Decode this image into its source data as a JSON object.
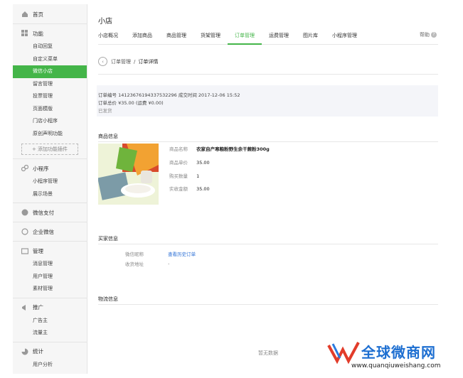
{
  "sidebar": {
    "home": "首页",
    "func_group": "功能",
    "func_items": [
      "自动回复",
      "自定义菜单",
      "微信小店",
      "留言管理",
      "投票管理",
      "页面模版",
      "门店小程序",
      "原创声明功能"
    ],
    "add_plugin": "+ 添加功能插件",
    "mini_group": "小程序",
    "mini_items": [
      "小程序管理",
      "展示场景"
    ],
    "pay": "微信支付",
    "work": "企业微信",
    "manage_group": "管理",
    "manage_items": [
      "消息管理",
      "用户管理",
      "素材管理"
    ],
    "promo_group": "推广",
    "promo_items": [
      "广告主",
      "流量主"
    ],
    "stats_group": "统计",
    "stats_items": [
      "用户分析"
    ]
  },
  "header": {
    "title": "小店",
    "tabs": [
      "小店概况",
      "添加商品",
      "商品管理",
      "货架管理",
      "订单管理",
      "运费管理",
      "图片库",
      "小程序管理"
    ],
    "active_tab": "订单管理",
    "help": "帮助"
  },
  "breadcrumb": {
    "parent": "订单管理",
    "sep": "/",
    "current": "订单详情"
  },
  "order": {
    "line1": "订单编号  14123676194337532296   成交时间  2017-12-06 15:52",
    "line2": "订单总价  ¥35.00 (运费  ¥0.00)",
    "status": "已发货"
  },
  "product": {
    "section": "商品信息",
    "name_label": "商品名称",
    "name": "农家自产寒粮粉野生余干蕨粉300g",
    "price_label": "商品单价",
    "price": "35.00",
    "qty_label": "购买数量",
    "qty": "1",
    "paid_label": "实收金额",
    "paid": "35.00"
  },
  "buyer": {
    "section": "买家信息",
    "nick_label": "微信昵称",
    "history_link": "查看历史订单",
    "addr_label": "收货地址",
    "addr": "·"
  },
  "logistics": {
    "section": "物流信息",
    "empty": "暂无数据"
  },
  "watermark": {
    "text": "全球微商网",
    "url": "www.quanqiuweishang.com"
  },
  "colors": {
    "accent": "#44b549",
    "link": "#2b6fd6"
  }
}
